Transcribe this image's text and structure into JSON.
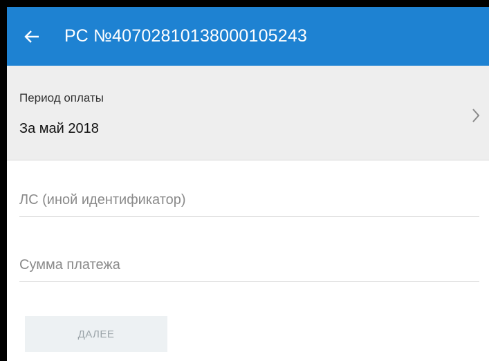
{
  "appbar": {
    "back_icon": "arrow-left-icon",
    "title": "РС №40702810138000105243",
    "color": "#1e82d2"
  },
  "period": {
    "label": "Период оплаты",
    "value": "За май 2018",
    "chevron_icon": "chevron-right-icon"
  },
  "fields": {
    "account_placeholder": "ЛС (иной идентификатор)",
    "amount_placeholder": "Сумма платежа"
  },
  "actions": {
    "next_label": "ДАЛЕЕ"
  }
}
